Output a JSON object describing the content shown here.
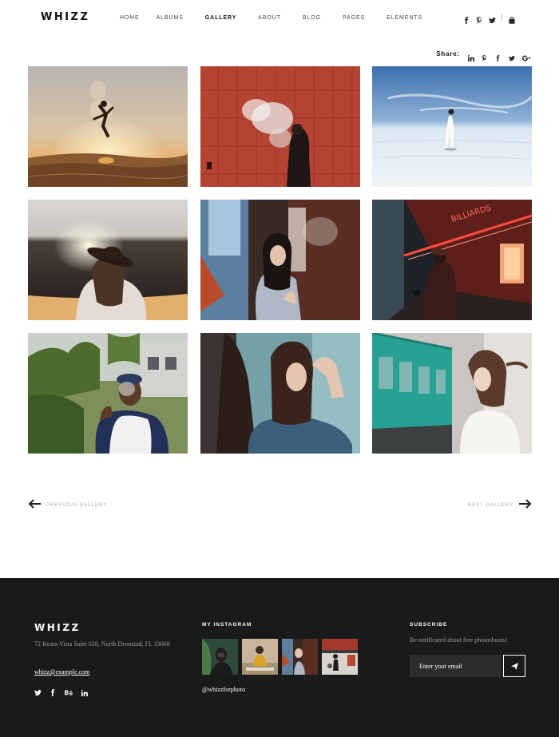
{
  "header": {
    "logo": "WHIZZ",
    "nav": [
      {
        "label": "HOME",
        "active": false
      },
      {
        "label": "ALBUMS",
        "active": false
      },
      {
        "label": "GALLERY",
        "active": true
      },
      {
        "label": "ABOUT",
        "active": false
      },
      {
        "label": "BLOG",
        "active": false
      },
      {
        "label": "PAGES",
        "active": false
      },
      {
        "label": "ELEMENTS",
        "active": false
      }
    ],
    "icons": [
      "facebook-icon",
      "pinterest-icon",
      "twitter-icon",
      "shopping-bag-icon"
    ]
  },
  "share": {
    "label": "Share:",
    "icons": [
      "linkedin-icon",
      "pinterest-icon",
      "facebook-icon",
      "twitter-icon",
      "google-plus-icon"
    ]
  },
  "gallery": {
    "photos": [
      "desert-jump-photo",
      "red-wall-smoke-photo",
      "salt-flat-photo",
      "sunset-hat-photo",
      "window-portrait-photo",
      "neon-street-photo",
      "man-smoking-photo",
      "woman-brunette-photo",
      "subway-woman-photo"
    ]
  },
  "pager": {
    "prev": "PREVIOUS GALLERY",
    "next": "NEXT GALLERY"
  },
  "footer": {
    "logo": "WHIZZ",
    "address": "72 Keara Vista Suite 028, North Deonstad, FL 33068",
    "email": "whizz@example.com",
    "social": [
      "twitter-icon",
      "facebook-icon",
      "behance-icon",
      "linkedin-icon"
    ],
    "instagram_title": "MY INSTAGRAM",
    "instagram_handle": "@whizzforphoto",
    "subscribe_title": "SUBSCRIBE",
    "subscribe_text": "Be notificated about free photoshoots!",
    "subscribe_placeholder": "Enter your email"
  },
  "colors": {
    "footer_bg": "#1a1a1a",
    "input_bg": "#2c2c2c",
    "muted_text": "#9a9a9a"
  }
}
